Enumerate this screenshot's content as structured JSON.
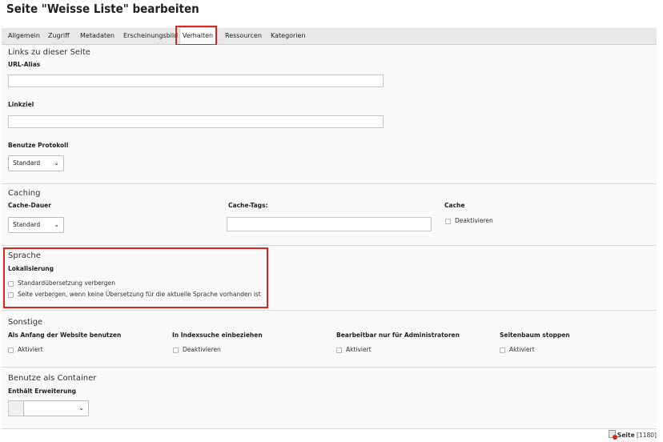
{
  "page": {
    "title": "Seite \"Weisse Liste\" bearbeiten"
  },
  "tabs": [
    {
      "label": "Allgemein"
    },
    {
      "label": "Zugriff"
    },
    {
      "label": "Metadaten"
    },
    {
      "label": "Erscheinungsbild"
    },
    {
      "label": "Verhalten"
    },
    {
      "label": "Ressourcen"
    },
    {
      "label": "Kategorien"
    }
  ],
  "links": {
    "section_title": "Links zu dieser Seite",
    "url_alias_label": "URL-Alias",
    "url_alias_value": "",
    "linkziel_label": "Linkziel",
    "linkziel_value": "",
    "protokoll_label": "Benutze Protokoll",
    "protokoll_value": "Standard"
  },
  "caching": {
    "section_title": "Caching",
    "dauer_label": "Cache-Dauer",
    "dauer_value": "Standard",
    "tags_label": "Cache-Tags:",
    "tags_value": "",
    "cache_label": "Cache",
    "cache_checkbox": "Deaktivieren"
  },
  "sprache": {
    "section_title": "Sprache",
    "lokalisierung_label": "Lokalisierung",
    "option1": "Standardübersetzung verbergen",
    "option2": "Seite verbergen, wenn keine Übersetzung für die aktuelle Sprache vorhanden ist"
  },
  "sonstige": {
    "section_title": "Sonstige",
    "col1_label": "Als Anfang der Website benutzen",
    "col1_checkbox": "Aktiviert",
    "col2_label": "In Indexsuche einbeziehen",
    "col2_checkbox": "Deaktivieren",
    "col3_label": "Bearbeitbar nur für Administratoren",
    "col3_checkbox": "Aktiviert",
    "col4_label": "Seitenbaum stoppen",
    "col4_checkbox": "Aktiviert"
  },
  "container": {
    "section_title": "Benutze als Container",
    "erweiterung_label": "Enthält Erweiterung",
    "erweiterung_value": ""
  },
  "footer": {
    "label": "Seite",
    "id": "[1180]"
  },
  "colors": {
    "highlight": "#e0241b",
    "panel_bg": "#f9f9f9",
    "tab_bar_bg": "#e8e8e8"
  }
}
